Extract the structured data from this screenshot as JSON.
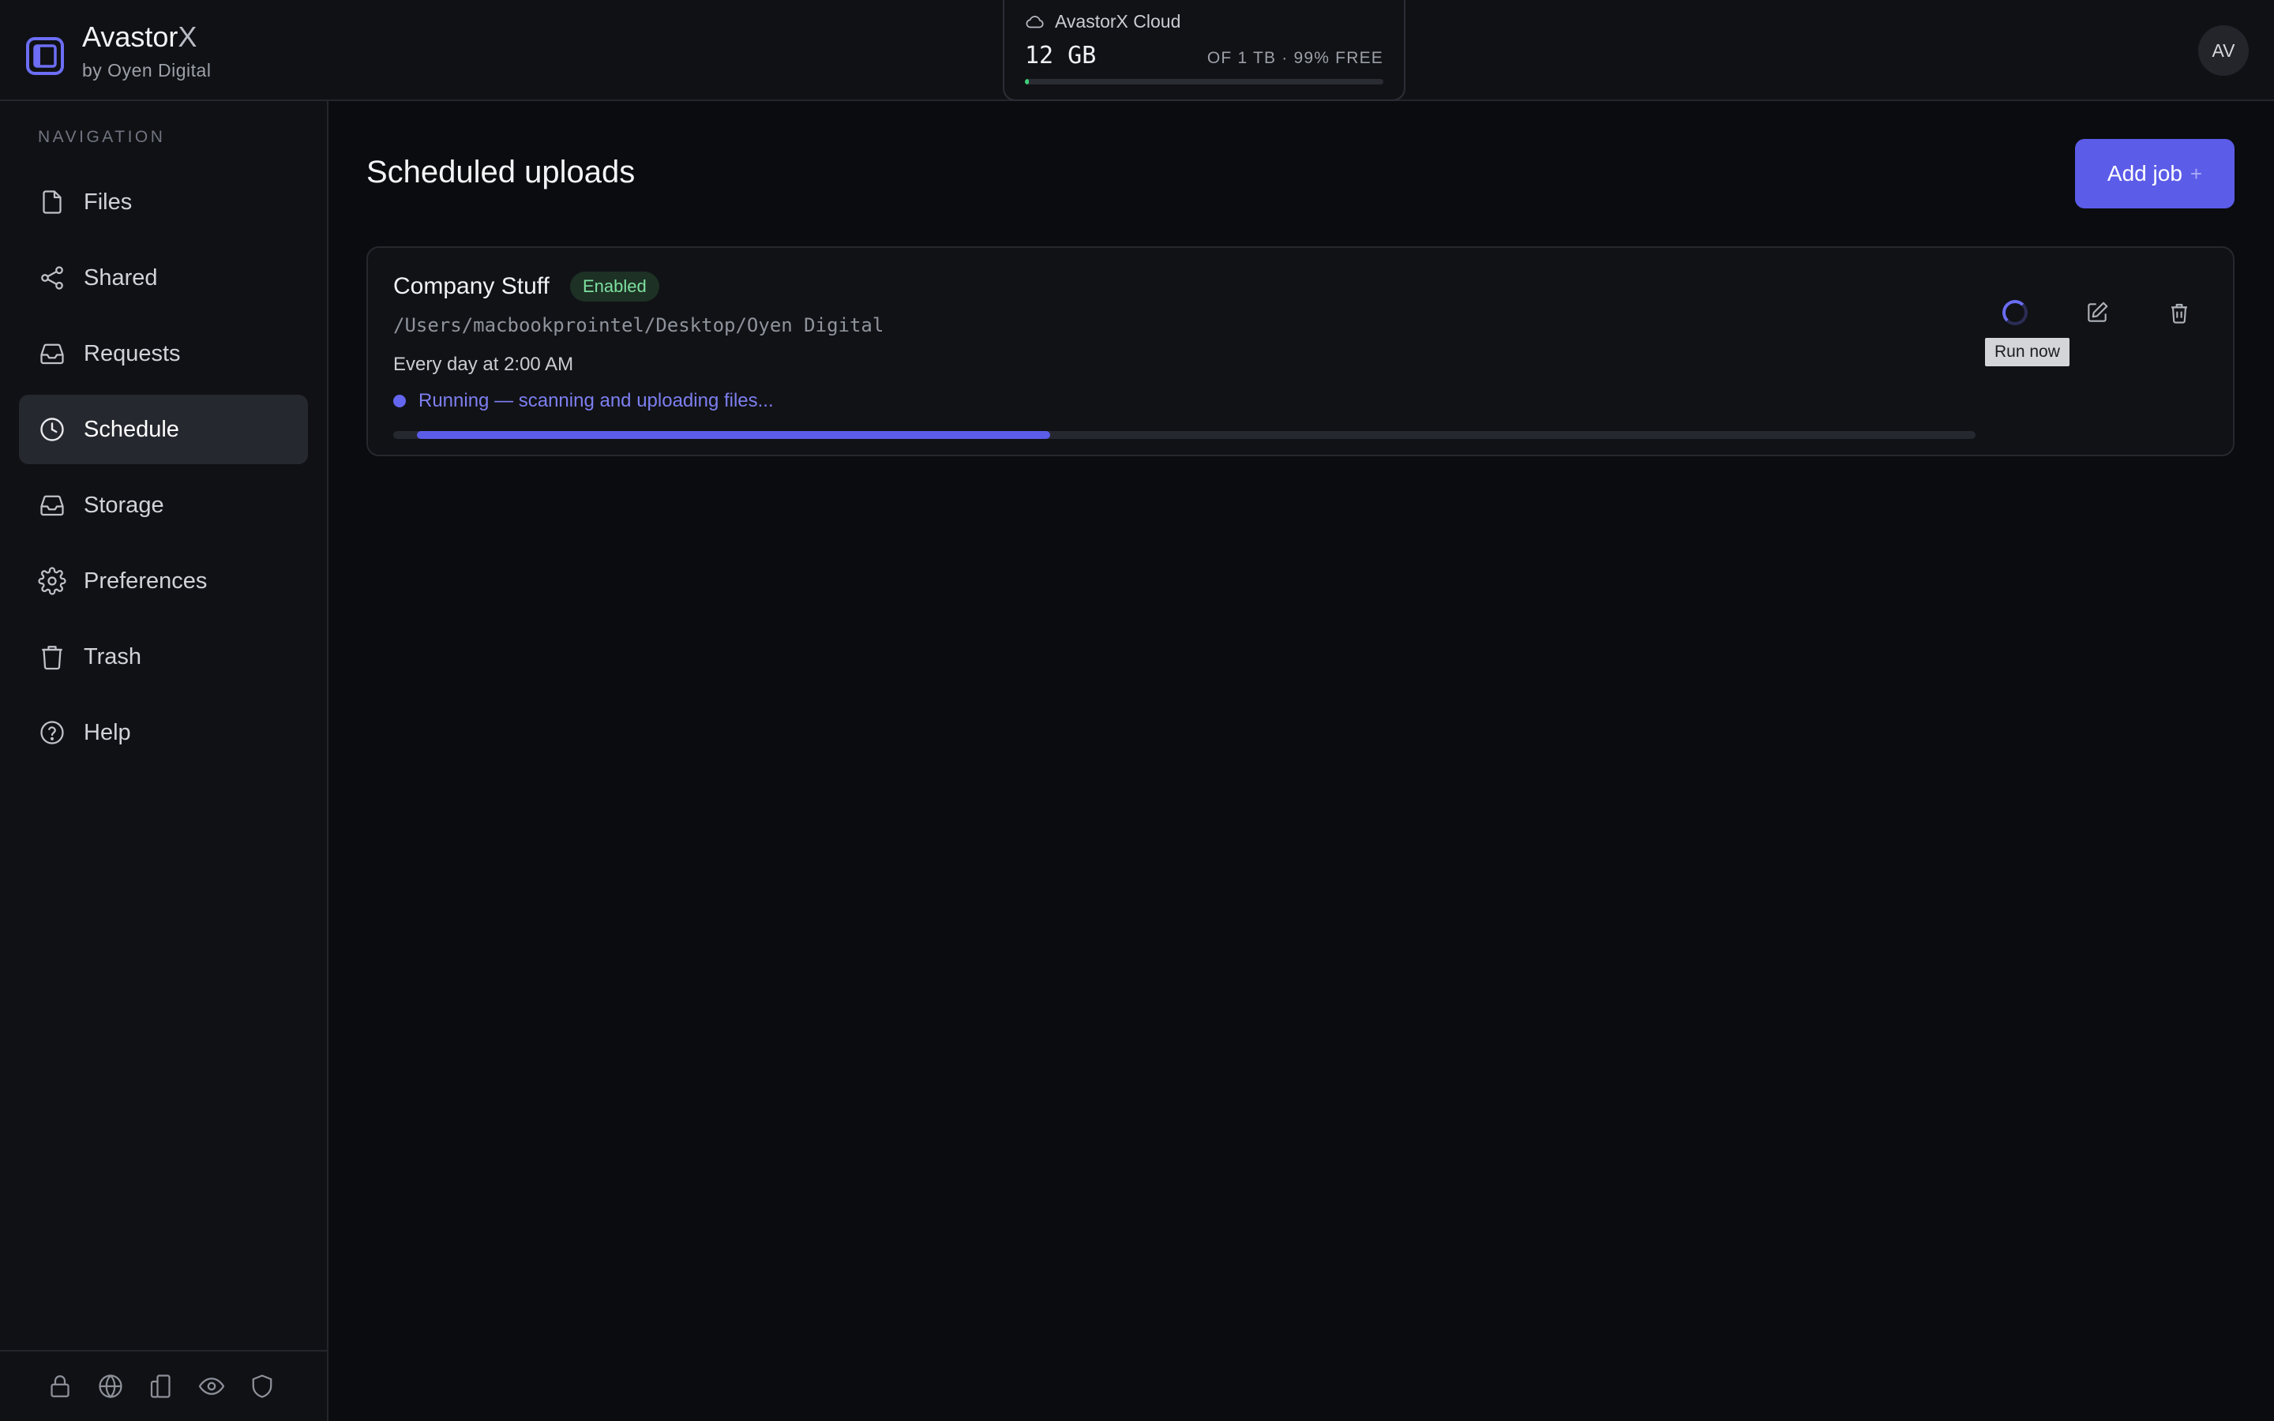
{
  "app": {
    "name": "Avastor",
    "name_suffix": "X",
    "subtitle": "by Oyen Digital",
    "avatar_initials": "AV"
  },
  "storage": {
    "label": "AvastorX Cloud",
    "used": "12 GB",
    "quota": "OF 1 TB · 99% FREE",
    "used_fraction": 0.012
  },
  "sidebar": {
    "heading": "NAVIGATION",
    "items": [
      {
        "label": "Files",
        "icon": "file-icon"
      },
      {
        "label": "Shared",
        "icon": "share-icon"
      },
      {
        "label": "Requests",
        "icon": "inbox-icon"
      },
      {
        "label": "Schedule",
        "icon": "clock-icon",
        "active": true
      },
      {
        "label": "Storage",
        "icon": "inbox-icon"
      },
      {
        "label": "Preferences",
        "icon": "gear-icon"
      },
      {
        "label": "Trash",
        "icon": "trash-icon"
      },
      {
        "label": "Help",
        "icon": "help-icon"
      }
    ],
    "footer_icons": [
      "lock-icon",
      "globe-icon",
      "devices-icon",
      "eye-icon",
      "shield-icon"
    ]
  },
  "main": {
    "title": "Scheduled uploads",
    "add_job_label": "Add job",
    "jobs": [
      {
        "name": "Company Stuff",
        "status_badge": "Enabled",
        "path": "/Users/macbookprointel/Desktop/Oyen Digital",
        "schedule": "Every day at 2:00 AM",
        "status_text": "Running — scanning and uploading files...",
        "progress_start": 0.015,
        "progress_end": 0.415,
        "tooltip": "Run now"
      }
    ]
  },
  "colors": {
    "accent": "#5b5ce8",
    "background": "#0b0c0f",
    "success": "#3fd07a"
  }
}
